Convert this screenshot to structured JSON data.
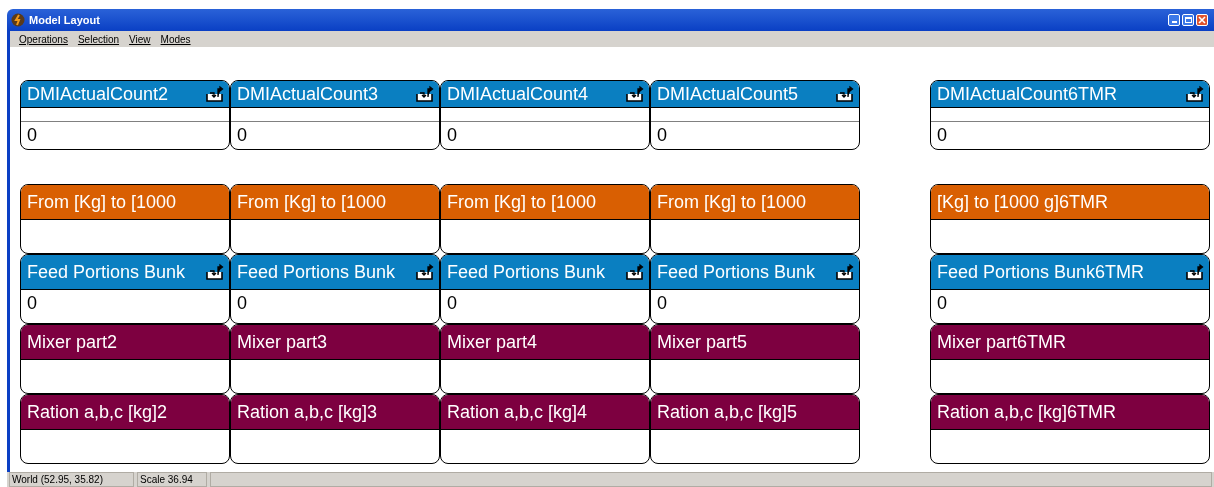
{
  "window": {
    "title": "Model Layout"
  },
  "menu": [
    "Operations",
    "Selection",
    "View",
    "Modes"
  ],
  "rows": [
    {
      "kind": "counter",
      "cards": [
        {
          "title": "DMIActualCount2",
          "color": "#0a7fc1",
          "icon": true,
          "value": "0"
        },
        {
          "title": "DMIActualCount3",
          "color": "#0a7fc1",
          "icon": true,
          "value": "0"
        },
        {
          "title": "DMIActualCount4",
          "color": "#0a7fc1",
          "icon": true,
          "value": "0"
        },
        {
          "title": "DMIActualCount5",
          "color": "#0a7fc1",
          "icon": true,
          "value": "0"
        },
        {
          "title": "DMIActualCount6TMR",
          "color": "#0a7fc1",
          "icon": true,
          "value": "0"
        }
      ]
    },
    {
      "kind": "plain",
      "cards": [
        {
          "title": "From [Kg] to [1000",
          "color": "#d95f02",
          "icon": false
        },
        {
          "title": "From [Kg] to [1000",
          "color": "#d95f02",
          "icon": false
        },
        {
          "title": "From [Kg] to [1000",
          "color": "#d95f02",
          "icon": false
        },
        {
          "title": "From [Kg] to [1000",
          "color": "#d95f02",
          "icon": false
        },
        {
          "title": "[Kg] to [1000 g]6TMR",
          "color": "#d95f02",
          "icon": false
        }
      ]
    },
    {
      "kind": "plain",
      "cards": [
        {
          "title": "Feed Portions Bunk",
          "color": "#0a7fc1",
          "icon": true,
          "value": "0"
        },
        {
          "title": "Feed Portions Bunk",
          "color": "#0a7fc1",
          "icon": true,
          "value": "0"
        },
        {
          "title": "Feed Portions Bunk",
          "color": "#0a7fc1",
          "icon": true,
          "value": "0"
        },
        {
          "title": "Feed Portions Bunk",
          "color": "#0a7fc1",
          "icon": true,
          "value": "0"
        },
        {
          "title": "Feed Portions Bunk6TMR",
          "color": "#0a7fc1",
          "icon": true,
          "value": "0"
        }
      ]
    },
    {
      "kind": "plain",
      "cards": [
        {
          "title": "Mixer part2",
          "color": "#7d0040",
          "icon": false
        },
        {
          "title": "Mixer part3",
          "color": "#7d0040",
          "icon": false
        },
        {
          "title": "Mixer part4",
          "color": "#7d0040",
          "icon": false
        },
        {
          "title": "Mixer part5",
          "color": "#7d0040",
          "icon": false
        },
        {
          "title": "Mixer part6TMR",
          "color": "#7d0040",
          "icon": false
        }
      ]
    },
    {
      "kind": "plain",
      "cards": [
        {
          "title": "Ration a,b,c [kg]2",
          "color": "#7d0040",
          "icon": false
        },
        {
          "title": "Ration a,b,c [kg]3",
          "color": "#7d0040",
          "icon": false
        },
        {
          "title": "Ration a,b,c [kg]4",
          "color": "#7d0040",
          "icon": false
        },
        {
          "title": "Ration a,b,c [kg]5",
          "color": "#7d0040",
          "icon": false
        },
        {
          "title": "Ration a,b,c [kg]6TMR",
          "color": "#7d0040",
          "icon": false
        }
      ]
    }
  ],
  "status_bar": [
    "World (52.95, 35.82)",
    "Scale 36.94"
  ]
}
